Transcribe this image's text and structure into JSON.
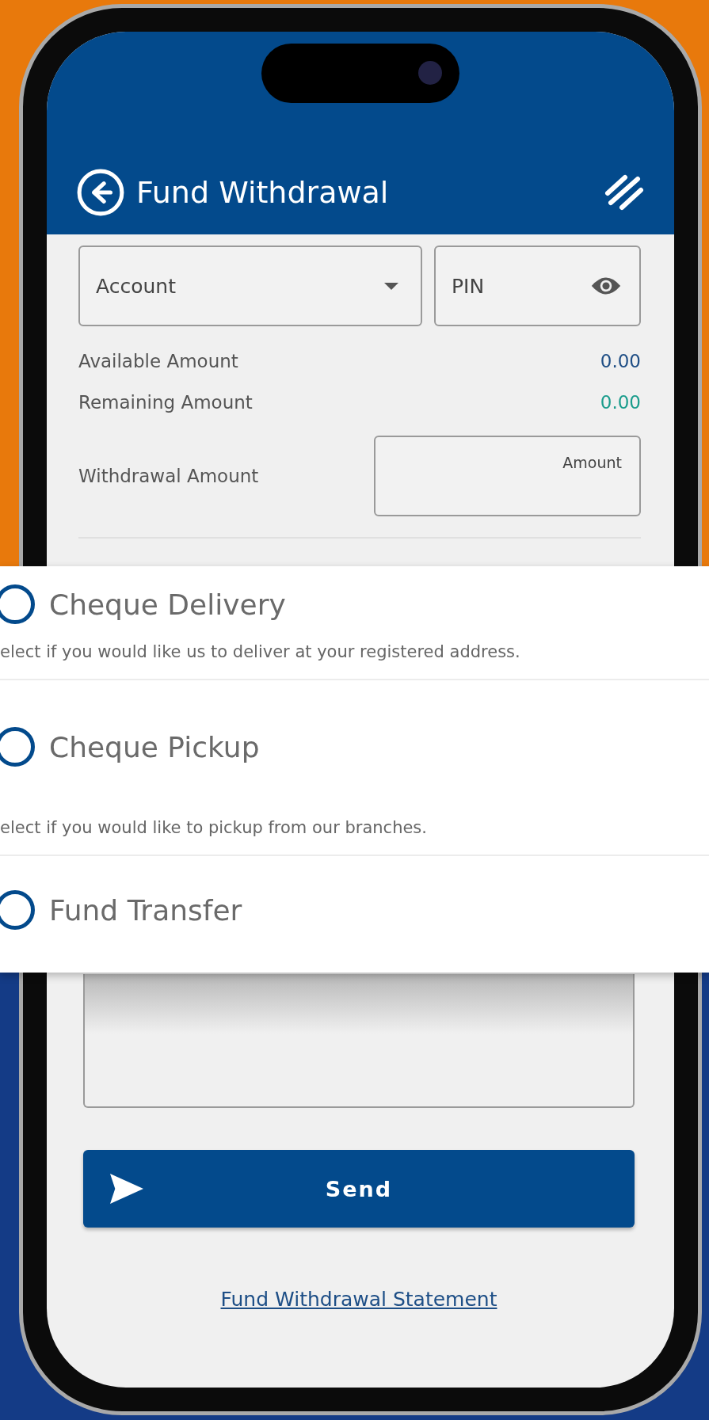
{
  "header": {
    "title": "Fund Withdrawal"
  },
  "form": {
    "account": {
      "label": "Account"
    },
    "pin": {
      "placeholder": "PIN"
    },
    "amounts": [
      {
        "label": "Available Amount",
        "value": "0.00",
        "color": "#1f4e85"
      },
      {
        "label": "Remaining Amount",
        "value": "0.00",
        "color": "#1a9c8c"
      }
    ],
    "withdrawal": {
      "label": "Withdrawal Amount",
      "placeholder": "Amount"
    }
  },
  "delivery_options": [
    {
      "label": "Cheque Delivery",
      "description": "elect if you would like us to deliver at your registered address.",
      "selected": false
    },
    {
      "label": "Cheque Pickup",
      "description": "elect if you would like to pickup from our branches.",
      "selected": false
    },
    {
      "label": "Fund Transfer",
      "selected": false
    }
  ],
  "send_button": {
    "label": "Send"
  },
  "statement_link": {
    "label": "Fund Withdrawal Statement"
  }
}
